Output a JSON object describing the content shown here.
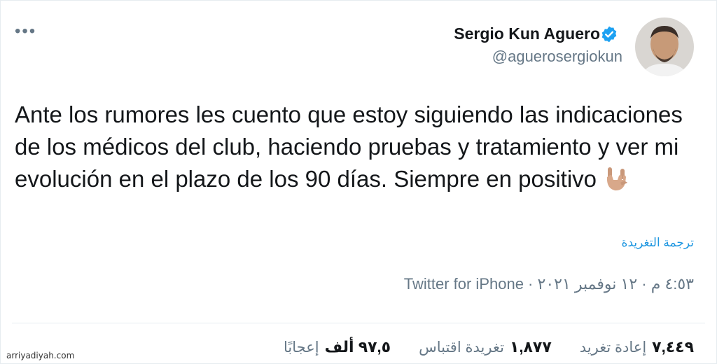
{
  "tweet": {
    "author": {
      "display_name": "Sergio Kun Aguero",
      "handle": "@aguerosergiokun",
      "verified": true,
      "avatar_icon": "profile-photo"
    },
    "more_icon": "ellipsis-icon",
    "text": "Ante los rumores les cuento que estoy siguiendo las indicaciones de los médicos del club, haciendo pruebas y tratamiento y ver mi evolución en el plazo de los 90 días. Siempre en positivo",
    "emoji_icon": "sign-of-the-horns-medium-light-skin-tone",
    "translate_label": "ترجمة التغريدة",
    "timestamp": "٤:٥٣ م · ١٢ نوفمبر ٢٠٢١ · ",
    "source": "Twitter for iPhone",
    "stats": {
      "retweets_count": "٧,٤٤٩",
      "retweets_label": "إعادة تغريد",
      "quotes_count": "١,٨٧٧",
      "quotes_label": "تغريدة اقتباس",
      "likes_count": "٩٧,٥ ألف",
      "likes_label": "إعجابًا"
    }
  },
  "watermark": "arriyadiyah.com",
  "colors": {
    "link": "#1b95e0",
    "secondary_text": "#657786",
    "primary_text": "#14171a",
    "verified_badge": "#1da1f2"
  }
}
